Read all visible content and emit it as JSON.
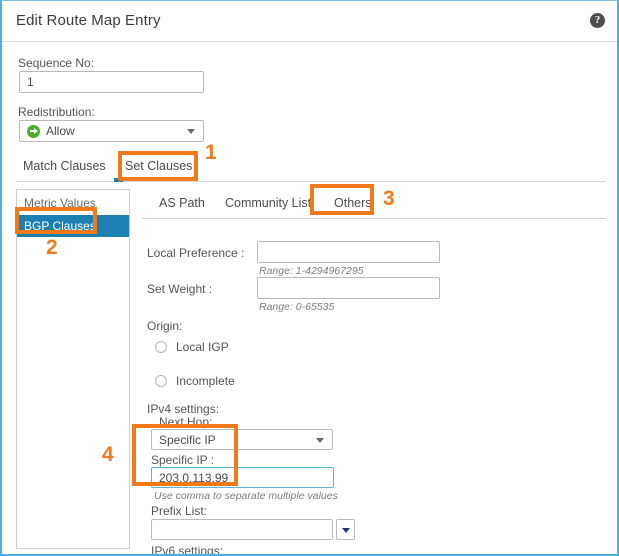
{
  "dialog": {
    "title": "Edit Route Map Entry",
    "help_icon": "help-circle-icon"
  },
  "form": {
    "sequence_label": "Sequence No:",
    "sequence_value": "1",
    "sequence_placeholder": "",
    "redistribution_label": "Redistribution:",
    "redistribution_value": "Allow",
    "redistribution_icon": "green-allow-arrow-icon"
  },
  "outer_tabs": [
    {
      "label": "Match Clauses",
      "selected": false
    },
    {
      "label": "Set Clauses",
      "selected": true
    }
  ],
  "clause_list": [
    {
      "label": "Metric Values",
      "selected": false
    },
    {
      "label": "BGP Clauses",
      "selected": true
    }
  ],
  "inner_tabs": [
    {
      "label": "AS Path",
      "selected": false
    },
    {
      "label": "Community List",
      "selected": false
    },
    {
      "label": "Others",
      "selected": true
    }
  ],
  "others_pane": {
    "local_preference_label": "Local Preference :",
    "local_preference_value": "",
    "local_preference_hint": "Range: 1-4294967295",
    "set_weight_label": "Set Weight :",
    "set_weight_value": "",
    "set_weight_hint": "Range: 0-65535",
    "origin_label": "Origin:",
    "origin_options": [
      {
        "label": "Local IGP",
        "selected": false
      },
      {
        "label": "Incomplete",
        "selected": false
      }
    ],
    "ipv4_settings_label": "IPv4 settings:",
    "next_hop_label": "Next Hop:",
    "next_hop_value": "Specific IP",
    "specific_ip_label": "Specific IP :",
    "specific_ip_value": "203.0.113.99",
    "specific_ip_hint": "Use comma to separate multiple values",
    "prefix_list_label": "Prefix List:",
    "prefix_list_value": "",
    "ipv6_settings_label": "IPv6 settings:"
  },
  "annotations": [
    {
      "number": "1",
      "target": "set-clauses-tab"
    },
    {
      "number": "2",
      "target": "bgp-clauses-list-item"
    },
    {
      "number": "3",
      "target": "others-tab"
    },
    {
      "number": "4",
      "target": "specific-ip-group"
    }
  ],
  "colors": {
    "annotation_orange": "#f07a1a",
    "selection_blue": "#1c80b3",
    "dialog_border_blue": "#4fb0de",
    "allow_green": "#4caf2a",
    "focus_border": "#57b4e4"
  }
}
